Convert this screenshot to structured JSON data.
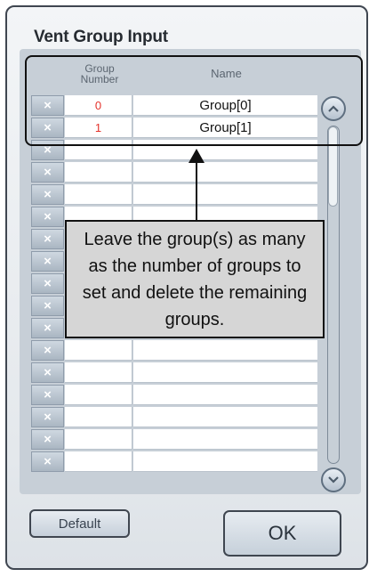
{
  "dialog": {
    "title": "Vent Group Input",
    "columns": {
      "group_number": "Group\nNumber",
      "name": "Name"
    },
    "rows": [
      {
        "number": "0",
        "name": "Group[0]"
      },
      {
        "number": "1",
        "name": "Group[1]"
      },
      {
        "number": "",
        "name": ""
      },
      {
        "number": "",
        "name": ""
      },
      {
        "number": "",
        "name": ""
      },
      {
        "number": "",
        "name": ""
      },
      {
        "number": "",
        "name": ""
      },
      {
        "number": "",
        "name": ""
      },
      {
        "number": "",
        "name": ""
      },
      {
        "number": "",
        "name": ""
      },
      {
        "number": "",
        "name": ""
      },
      {
        "number": "",
        "name": ""
      },
      {
        "number": "",
        "name": ""
      },
      {
        "number": "",
        "name": ""
      },
      {
        "number": "",
        "name": ""
      },
      {
        "number": "",
        "name": ""
      },
      {
        "number": "",
        "name": ""
      }
    ],
    "delete_symbol": "×",
    "default_label": "Default",
    "ok_label": "OK"
  },
  "callout": {
    "text": "Leave the group(s) as many as the number of groups to set and delete the remaining groups."
  },
  "colors": {
    "group_number_text": "#e4322b",
    "panel": "#c7cfd7",
    "callout_bg": "#d6d6d6"
  },
  "icons": {
    "scroll_up": "chevron-up-icon",
    "scroll_down": "chevron-down-icon",
    "delete": "close-icon"
  }
}
